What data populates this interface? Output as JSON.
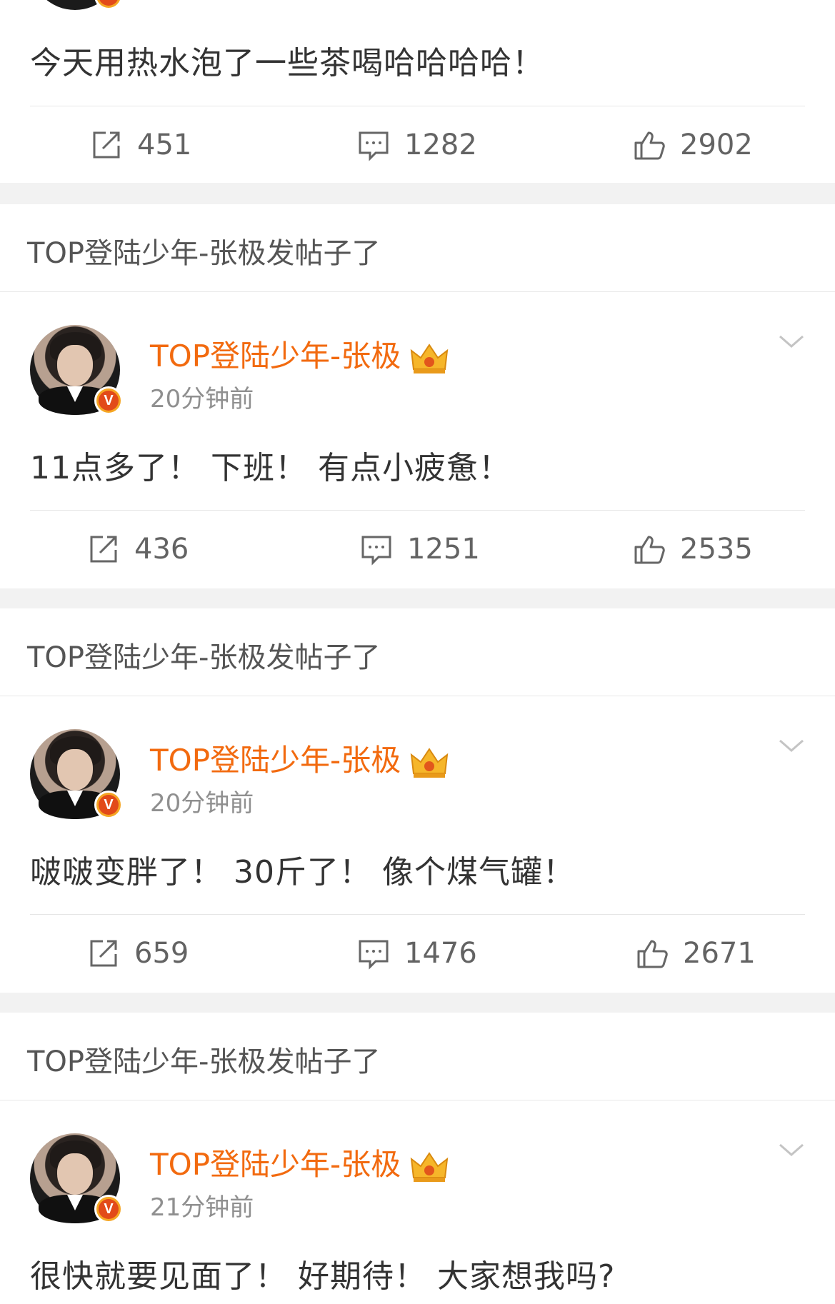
{
  "posts": [
    {
      "header": "",
      "username": "",
      "time": "",
      "text": "今天用热水泡了一些茶喝哈哈哈哈！",
      "reposts": "451",
      "comments": "1282",
      "likes": "2902"
    },
    {
      "header": "TOP登陆少年-张极发帖子了",
      "username": "TOP登陆少年-张极",
      "time": "20分钟前",
      "text": "11点多了！ 下班！ 有点小疲惫！",
      "reposts": "436",
      "comments": "1251",
      "likes": "2535"
    },
    {
      "header": "TOP登陆少年-张极发帖子了",
      "username": "TOP登陆少年-张极",
      "time": "20分钟前",
      "text": "啵啵变胖了！ 30斤了！ 像个煤气罐！",
      "reposts": "659",
      "comments": "1476",
      "likes": "2671"
    },
    {
      "header": "TOP登陆少年-张极发帖子了",
      "username": "TOP登陆少年-张极",
      "time": "21分钟前",
      "text": "很快就要见面了！ 好期待！ 大家想我吗?"
    }
  ],
  "badges": {
    "verified": "V"
  },
  "icons": {
    "repost": "repost-icon",
    "comment": "comment-icon",
    "like": "like-icon",
    "crown": "crown-icon",
    "chevron": "chevron-down-icon"
  },
  "colors": {
    "username": "#f26a0f",
    "verified_bg": "#e24a19",
    "verified_ring": "#f5a623"
  }
}
